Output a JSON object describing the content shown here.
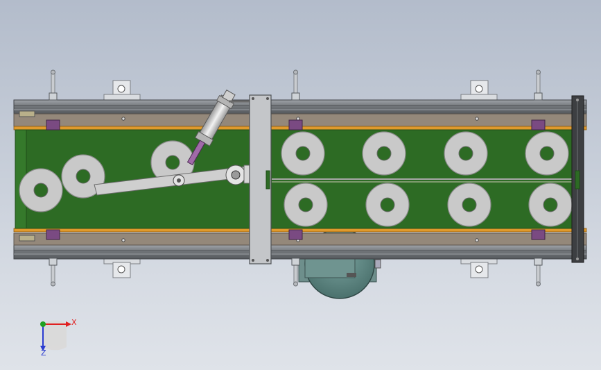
{
  "view": {
    "type": "CAD top view of belt conveyor with pneumatic pusher",
    "background_top": "#b3bccb",
    "background_bottom": "#dfe3e9"
  },
  "colors": {
    "belt": "#2d6b24",
    "belt_dark": "#1f4d19",
    "frame": "#8c8f93",
    "frame_dark": "#5e6165",
    "wood": "#94887a",
    "orange_strip": "#e09a2c",
    "disc": "#c9c9c9",
    "disc_edge": "#8a8a8a",
    "purple_block": "#7a4a82",
    "motor": "#5d8682",
    "cylinder": "#d8d8d8"
  },
  "parts": {
    "discs_upper_row": 4,
    "discs_lower_row": 4,
    "discs_left_area": 3,
    "support_rods": 3,
    "mounting_brackets": 4
  },
  "triad": {
    "x_label": "X",
    "z_label": "Z",
    "x_color": "#e02020",
    "y_color": "#20a020",
    "z_color": "#2a3bd0"
  }
}
